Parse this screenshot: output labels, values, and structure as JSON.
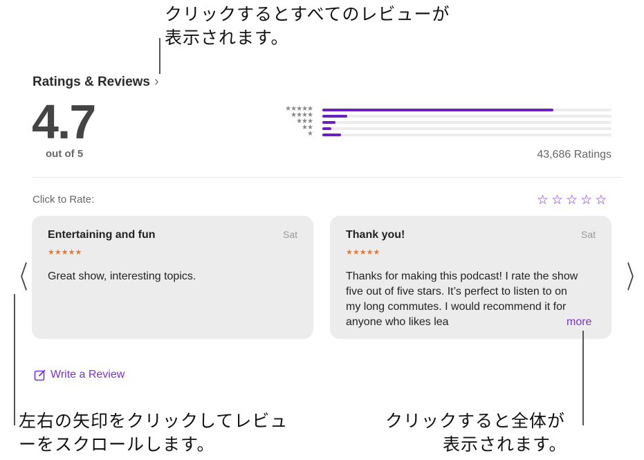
{
  "callouts": {
    "top_line1": "クリックするとすべてのレビューが",
    "top_line2": "表示されます。",
    "left_line1": "左右の矢印をクリックしてレビュ",
    "left_line2": "ーをスクロールします。",
    "right_line1": "クリックすると全体が",
    "right_line2": "表示されます。"
  },
  "ratings": {
    "title": "Ratings & Reviews",
    "chevron": "›",
    "score": "4.7",
    "out_of": "out of 5",
    "count_label": "43,686 Ratings",
    "histogram": [
      {
        "stars": "★★★★★",
        "fraction": 0.8
      },
      {
        "stars": "★★★★",
        "fraction": 0.085
      },
      {
        "stars": "★★★",
        "fraction": 0.045
      },
      {
        "stars": "★★",
        "fraction": 0.03
      },
      {
        "stars": "★",
        "fraction": 0.065
      }
    ]
  },
  "rate": {
    "label": "Click to Rate:",
    "stars": [
      "☆",
      "☆",
      "☆",
      "☆",
      "☆"
    ]
  },
  "reviews": [
    {
      "title": "Entertaining and fun",
      "date": "Sat",
      "stars": "★★★★★",
      "body": "Great show, interesting topics."
    },
    {
      "title": "Thank you!",
      "date": "Sat",
      "stars": "★★★★★",
      "body": "Thanks for making this podcast! I rate the show five out of five stars. It’s perfect to listen to on my long commutes. I would recommend it for anyone who likes lea",
      "more_label": "more"
    }
  ],
  "nav": {
    "prev": "〈",
    "next": "〉"
  },
  "write_review": {
    "label": "Write a Review"
  },
  "colors": {
    "accent": "#7a2fd8",
    "bar": "#6a1fc0",
    "card_stars": "#f0762a"
  }
}
